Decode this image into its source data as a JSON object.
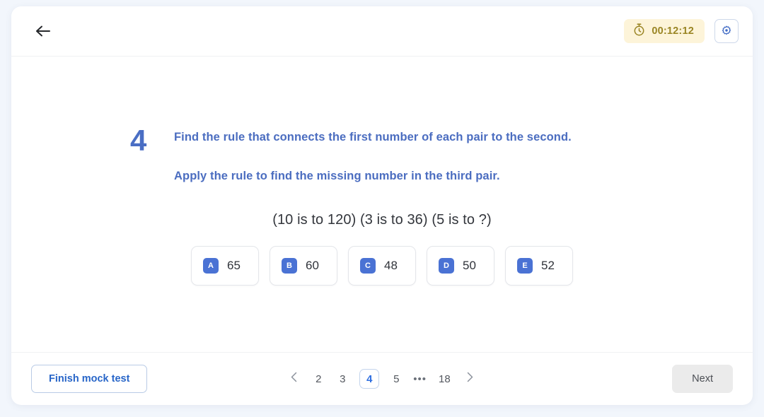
{
  "header": {
    "back_icon": "arrow-left-icon",
    "timer": {
      "icon": "stopwatch-icon",
      "value": "00:12:12"
    },
    "settings_icon": "gear-icon"
  },
  "question": {
    "number": "4",
    "prompt_lines": [
      "Find the rule that connects the first number of each pair to the second.",
      "Apply the rule to find the missing number in the third pair."
    ],
    "statement": "(10 is to 120) (3 is to 36) (5 is to ?)",
    "options": [
      {
        "letter": "A",
        "value": "65"
      },
      {
        "letter": "B",
        "value": "60"
      },
      {
        "letter": "C",
        "value": "48"
      },
      {
        "letter": "D",
        "value": "50"
      },
      {
        "letter": "E",
        "value": "52"
      }
    ]
  },
  "footer": {
    "finish_label": "Finish mock test",
    "next_label": "Next",
    "pagination": {
      "prev_icon": "chevron-left-icon",
      "next_icon": "chevron-right-icon",
      "pages": [
        "2",
        "3",
        "4",
        "5"
      ],
      "ellipsis": "•••",
      "last_page": "18",
      "current_page": "4"
    }
  },
  "colors": {
    "page_background": "#f2f6fc",
    "card_background": "#ffffff",
    "accent_blue": "#4a6ec4",
    "badge_blue": "#4a72d4",
    "timer_background": "#fdf4d9",
    "timer_text": "#9a8524",
    "link_blue": "#2765c8",
    "next_background": "#ebebeb"
  }
}
